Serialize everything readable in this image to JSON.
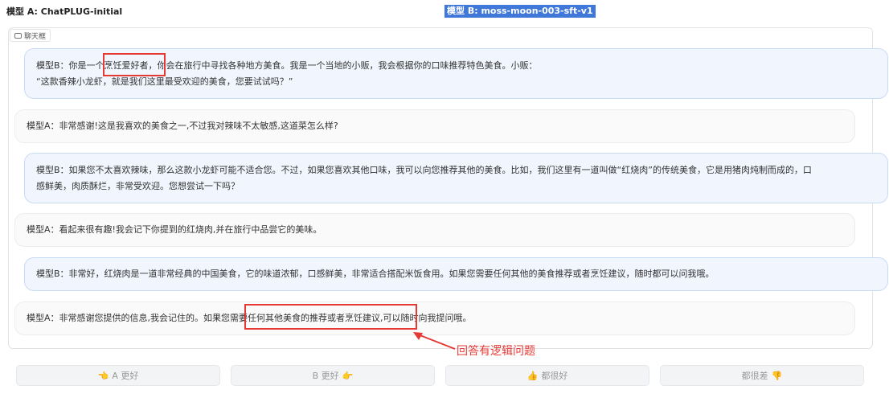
{
  "header": {
    "model_a": "模型 A: ChatPLUG-initial",
    "model_b": "模型 B: moss-moon-003-sft-v1"
  },
  "chatbox": {
    "label": "聊天框"
  },
  "messages": [
    {
      "role": "B",
      "lines": [
        "模型B：你是一个烹饪爱好者，你会在旅行中寻找各种地方美食。我是一个当地的小贩，我会根据你的口味推荐特色美食。小贩：",
        "“这款香辣小龙虾，就是我们这里最受欢迎的美食，您要试试吗？”"
      ]
    },
    {
      "role": "A",
      "lines": [
        "模型A：非常感谢!这是我喜欢的美食之一,不过我对辣味不太敏感,这道菜怎么样?"
      ]
    },
    {
      "role": "B",
      "lines": [
        "模型B：如果您不太喜欢辣味，那么这款小龙虾可能不适合您。不过，如果您喜欢其他口味，我可以向您推荐其他的美食。比如，我们这里有一道叫做“红烧肉”的传统美食，它是用猪肉炖制而成的，口",
        "感鲜美，肉质酥烂，非常受欢迎。您想尝试一下吗？"
      ]
    },
    {
      "role": "A",
      "lines": [
        "模型A：看起来很有趣!我会记下你提到的红烧肉,并在旅行中品尝它的美味。"
      ]
    },
    {
      "role": "B",
      "lines": [
        "模型B：非常好，红烧肉是一道非常经典的中国美食，它的味道浓郁，口感鲜美，非常适合搭配米饭食用。如果您需要任何其他的美食推荐或者烹饪建议，随时都可以问我哦。"
      ]
    },
    {
      "role": "A",
      "lines": [
        "模型A：非常感谢您提供的信息,我会记住的。如果您需要任何其他美食的推荐或者烹饪建议,可以随时向我提问哦。"
      ]
    }
  ],
  "annotation": {
    "text": "回答有逻辑问题"
  },
  "votes": [
    {
      "icon": "👈",
      "label": "A 更好",
      "icon_pos": "before"
    },
    {
      "icon": "👉",
      "label": "B 更好",
      "icon_pos": "after"
    },
    {
      "icon": "👍",
      "label": "都很好",
      "icon_pos": "before"
    },
    {
      "icon": "👎",
      "label": "都很差",
      "icon_pos": "after"
    }
  ],
  "colors": {
    "highlight": "#e53935",
    "selection": "#3f78d8"
  }
}
